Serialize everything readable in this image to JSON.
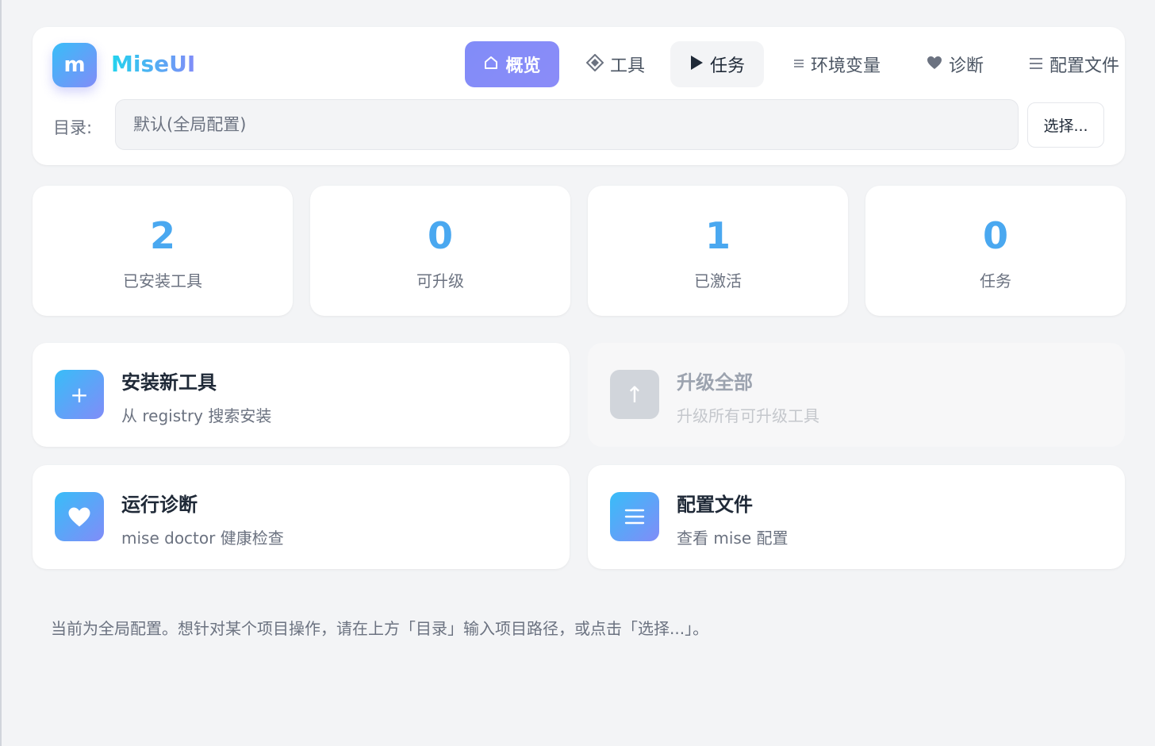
{
  "app": {
    "logo_letter": "m",
    "title": "MiseUI"
  },
  "nav": {
    "items": [
      {
        "label": "概览",
        "icon": "home-icon",
        "state": "active"
      },
      {
        "label": "工具",
        "icon": "diamond-icon",
        "state": "normal"
      },
      {
        "label": "任务",
        "icon": "play-icon",
        "state": "hover"
      },
      {
        "label": "环境变量",
        "icon": "list-icon",
        "state": "normal"
      },
      {
        "label": "诊断",
        "icon": "heart-icon",
        "state": "normal"
      },
      {
        "label": "配置文件",
        "icon": "menu-icon",
        "state": "normal"
      }
    ]
  },
  "directory": {
    "label": "目录:",
    "placeholder": "默认(全局配置)",
    "choose_label": "选择..."
  },
  "stats": [
    {
      "value": "2",
      "label": "已安装工具"
    },
    {
      "value": "0",
      "label": "可升级"
    },
    {
      "value": "1",
      "label": "已激活"
    },
    {
      "value": "0",
      "label": "任务"
    }
  ],
  "actions": [
    {
      "title": "安装新工具",
      "desc": "从 registry 搜索安装",
      "icon": "plus-icon",
      "glyph": "+",
      "enabled": true
    },
    {
      "title": "升级全部",
      "desc": "升级所有可升级工具",
      "icon": "arrow-up-icon",
      "glyph": "↑",
      "enabled": false
    },
    {
      "title": "运行诊断",
      "desc": "mise doctor 健康检查",
      "icon": "heart-icon",
      "glyph": "♥",
      "enabled": true
    },
    {
      "title": "配置文件",
      "desc": "查看 mise 配置",
      "icon": "menu-icon",
      "glyph": "☰",
      "enabled": true
    }
  ],
  "hint": "当前为全局配置。想针对某个项目操作，请在上方「目录」输入项目路径，或点击「选择...」。",
  "colors": {
    "accent_gradient_start": "#38bdf8",
    "accent_gradient_end": "#818cf8",
    "stat_value": "#4aa8f0",
    "background": "#f3f4f6"
  }
}
